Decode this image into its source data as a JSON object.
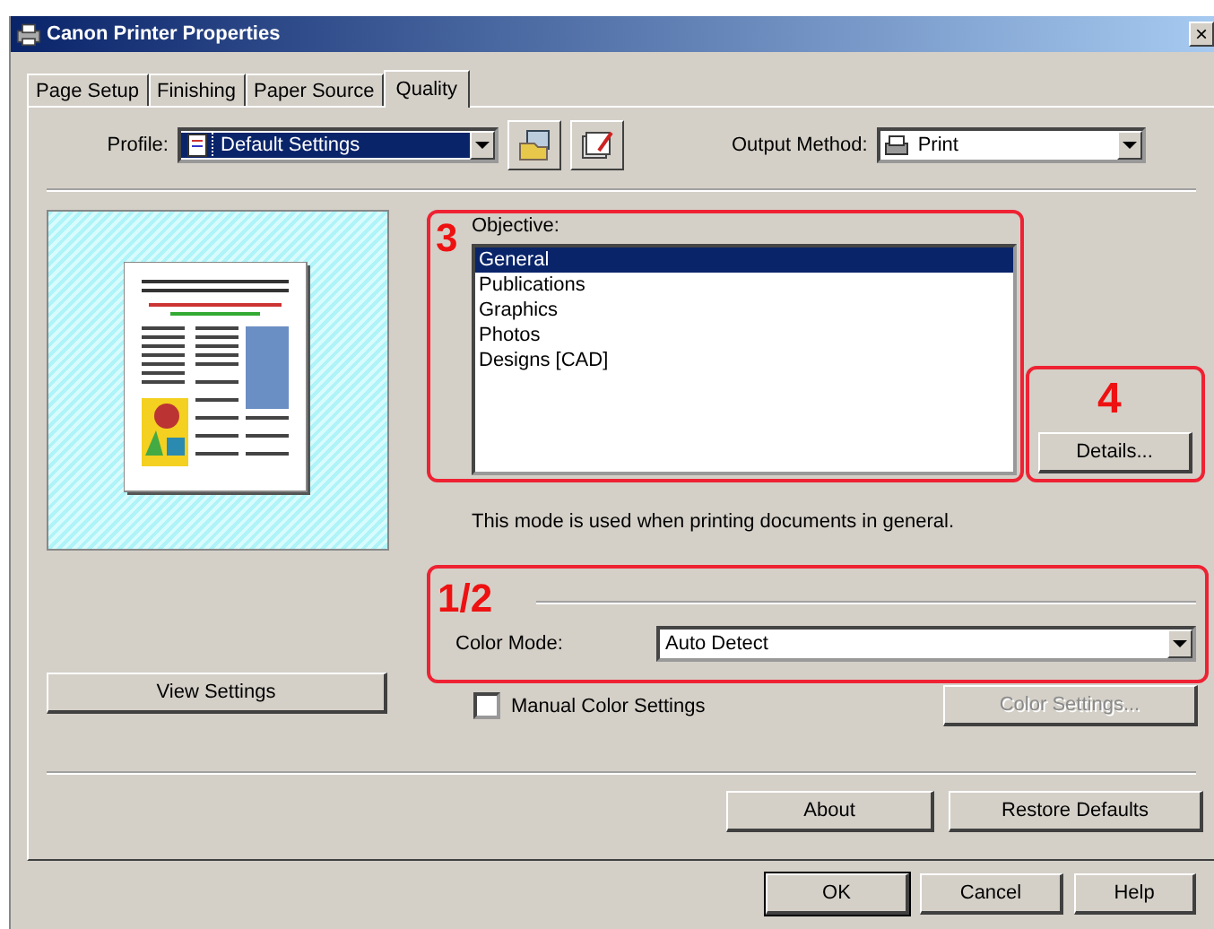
{
  "window": {
    "title": "Canon Printer Properties",
    "close": "×"
  },
  "tabs": [
    {
      "label": "Page Setup",
      "selected": false
    },
    {
      "label": "Finishing",
      "selected": false
    },
    {
      "label": "Paper Source",
      "selected": false
    },
    {
      "label": "Quality",
      "selected": true
    }
  ],
  "profile": {
    "label": "Profile:",
    "value": "Default Settings"
  },
  "output_method": {
    "label": "Output Method:",
    "value": "Print"
  },
  "objective": {
    "callout": "3",
    "label": "Objective:",
    "items": [
      {
        "label": "General",
        "selected": true
      },
      {
        "label": "Publications",
        "selected": false
      },
      {
        "label": "Graphics",
        "selected": false
      },
      {
        "label": "Photos",
        "selected": false
      },
      {
        "label": "Designs [CAD]",
        "selected": false
      }
    ]
  },
  "details": {
    "callout": "4",
    "button": "Details..."
  },
  "description": "This mode is used when printing documents in general.",
  "color_mode": {
    "callout": "1/2",
    "label": "Color Mode:",
    "value": "Auto Detect"
  },
  "manual_color": {
    "label": "Manual Color Settings",
    "checked": false
  },
  "color_settings": {
    "label": "Color Settings...",
    "disabled": true
  },
  "view_settings": "View Settings",
  "panel_buttons": [
    "About",
    "Restore Defaults"
  ],
  "dialog_buttons": [
    "OK",
    "Cancel",
    "Help"
  ]
}
